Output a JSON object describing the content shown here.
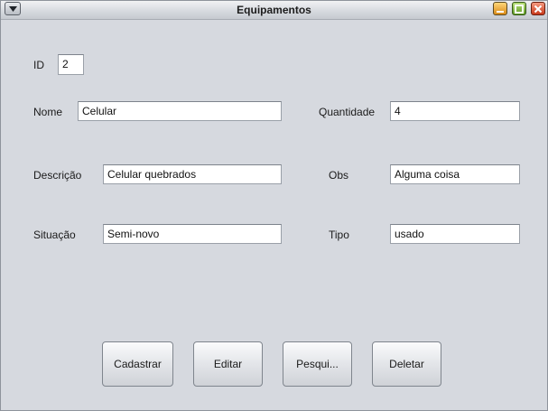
{
  "window": {
    "title": "Equipamentos"
  },
  "form": {
    "id": {
      "label": "ID",
      "value": "2"
    },
    "nome": {
      "label": "Nome",
      "value": "Celular"
    },
    "quantidade": {
      "label": "Quantidade",
      "value": "4"
    },
    "descricao": {
      "label": "Descrição",
      "value": "Celular quebrados"
    },
    "obs": {
      "label": "Obs",
      "value": "Alguma coisa"
    },
    "situacao": {
      "label": "Situação",
      "value": "Semi-novo"
    },
    "tipo": {
      "label": "Tipo",
      "value": "usado"
    }
  },
  "buttons": {
    "cadastrar": "Cadastrar",
    "editar": "Editar",
    "pesquisar": "Pesqui...",
    "deletar": "Deletar"
  },
  "colors": {
    "window_bg": "#d6d9df",
    "minimize": "#e8a83a",
    "maximize": "#7db640",
    "close": "#d9512e"
  },
  "icons": {
    "system_menu": "chevron-down-icon",
    "minimize": "minimize-icon",
    "maximize": "maximize-icon",
    "close": "close-icon"
  }
}
